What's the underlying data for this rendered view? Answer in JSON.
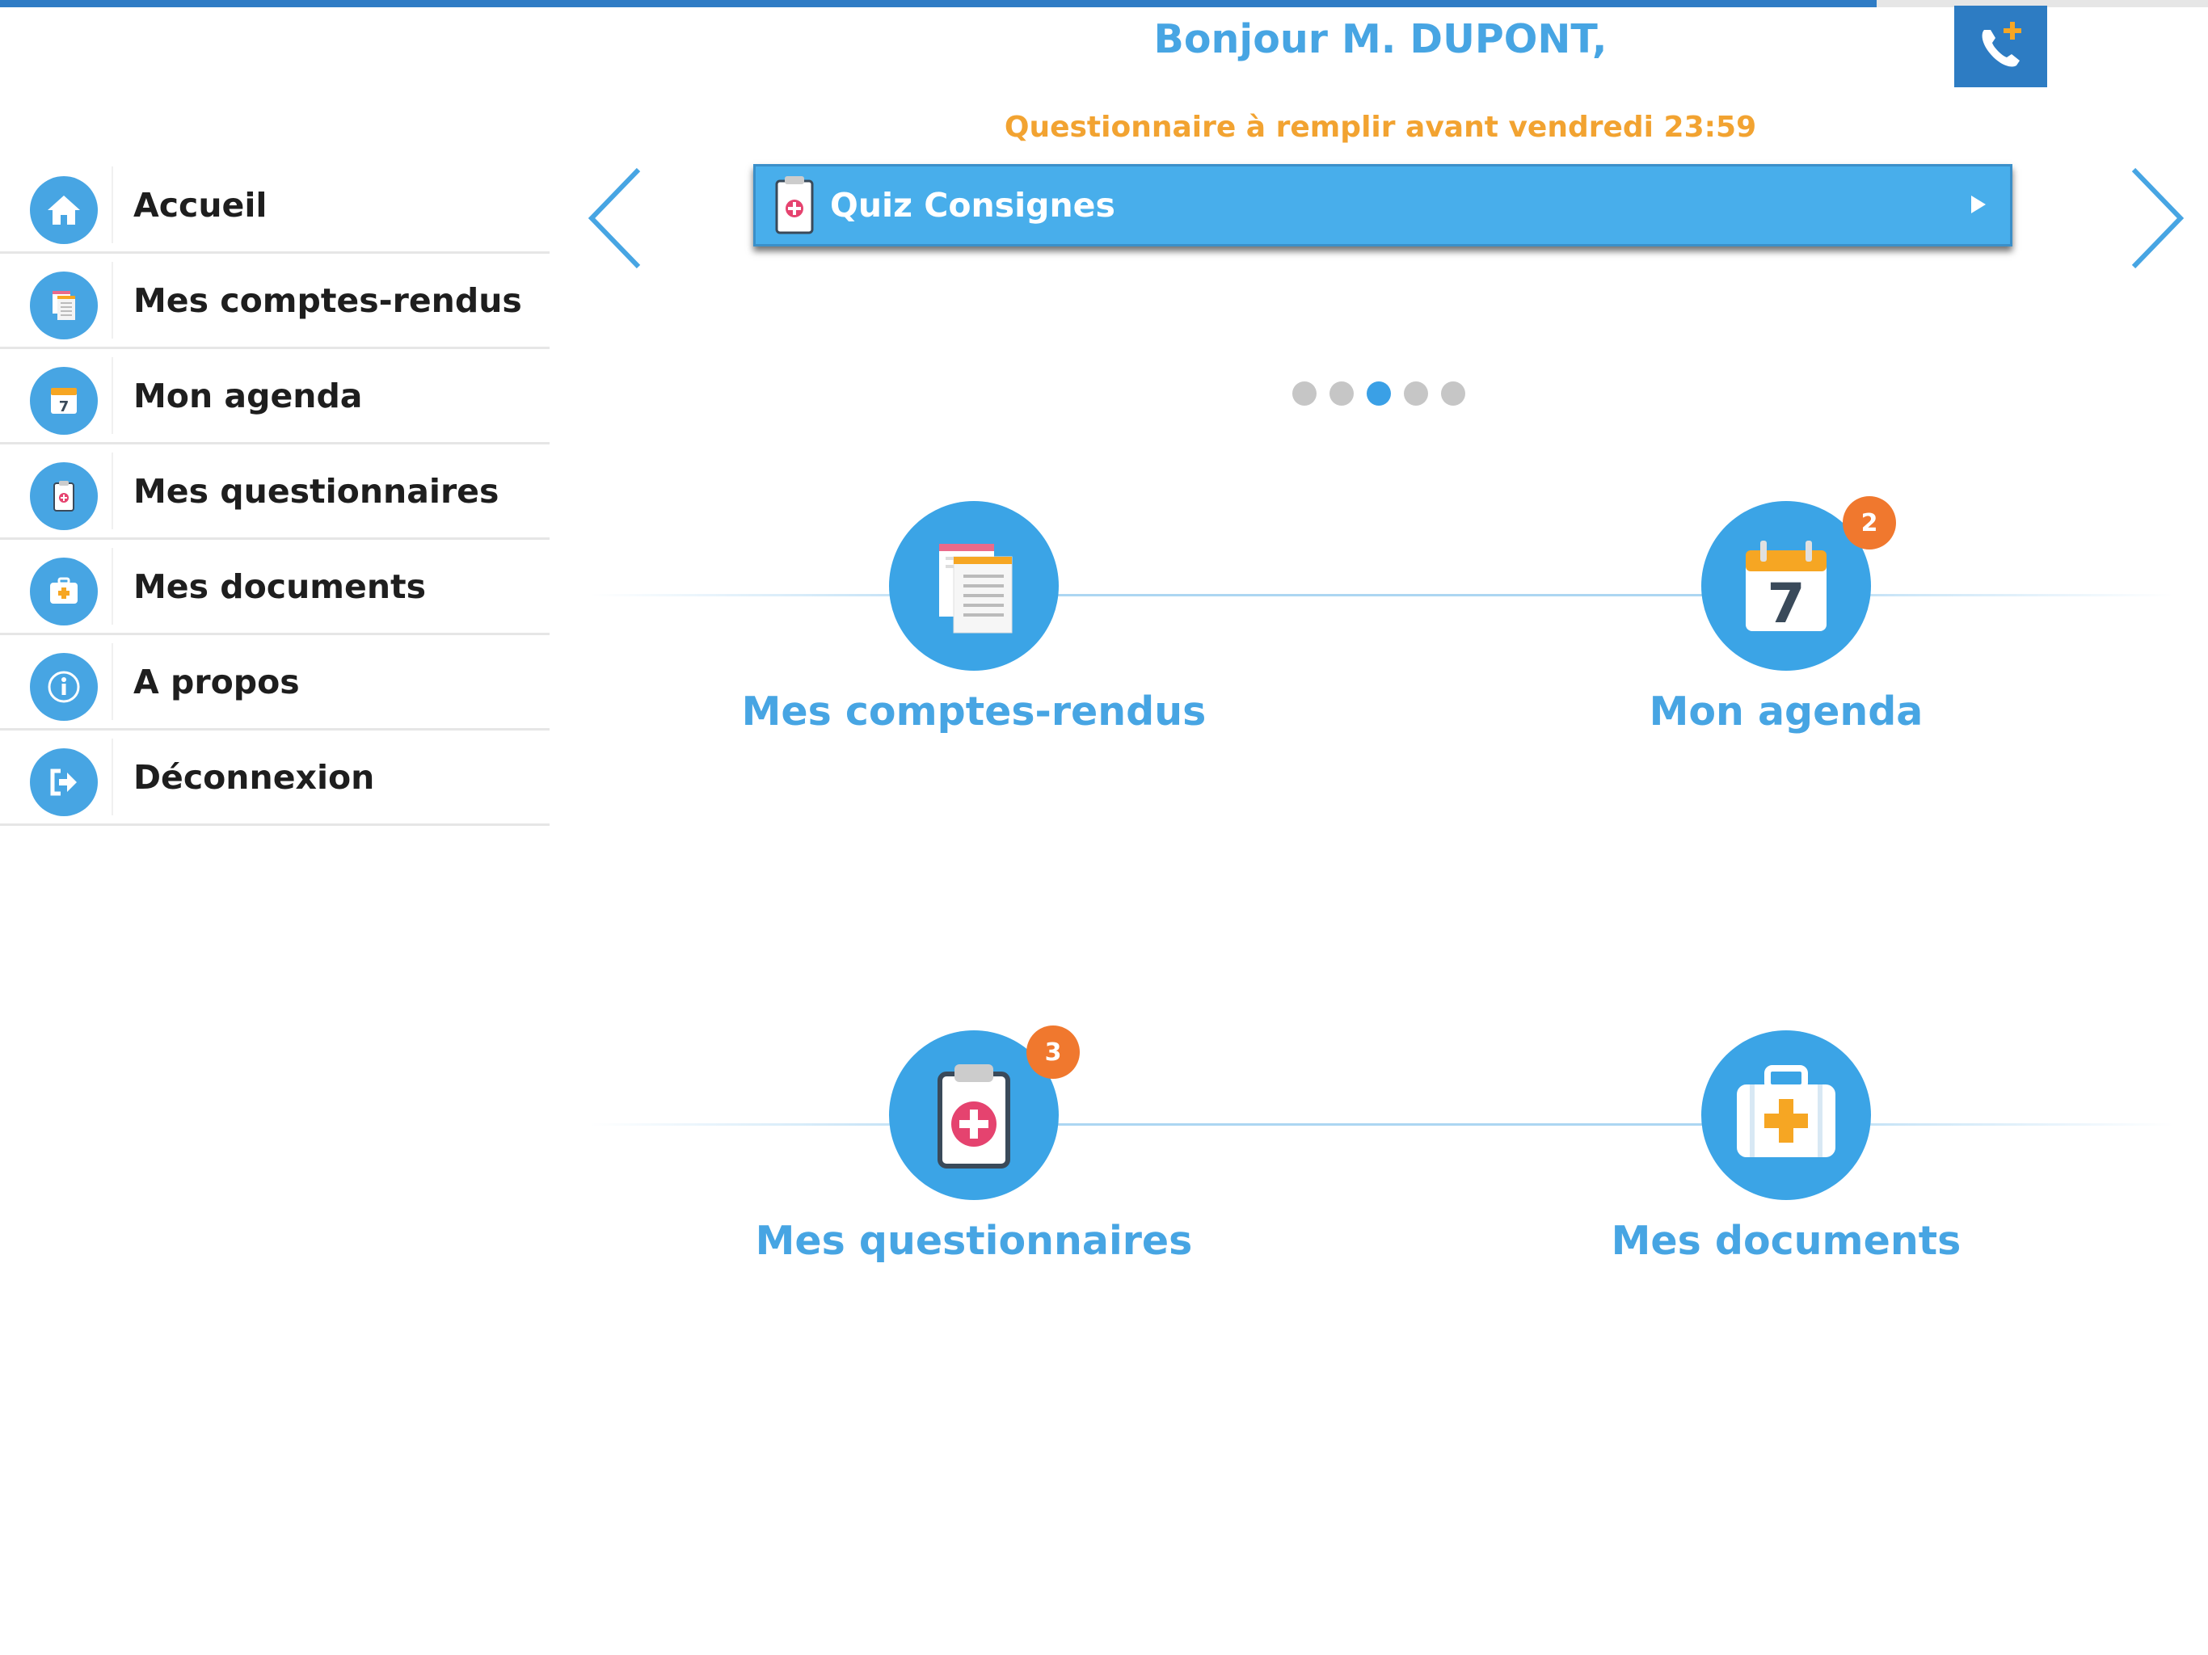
{
  "header": {
    "progress": 0.85,
    "greeting": "Bonjour M. DUPONT,",
    "deadline": "Questionnaire à remplir avant vendredi 23:59",
    "call_icon": "phone-add-icon"
  },
  "sidebar": {
    "items": [
      {
        "label": "Accueil",
        "icon": "home-icon"
      },
      {
        "label": "Mes comptes-rendus",
        "icon": "reports-icon"
      },
      {
        "label": "Mon agenda",
        "icon": "calendar-icon"
      },
      {
        "label": "Mes questionnaires",
        "icon": "clipboard-icon"
      },
      {
        "label": "Mes documents",
        "icon": "medical-case-icon"
      },
      {
        "label": "A propos",
        "icon": "info-icon"
      },
      {
        "label": "Déconnexion",
        "icon": "logout-icon"
      }
    ]
  },
  "carousel": {
    "card_label": "Quiz Consignes",
    "card_icon": "clipboard-icon",
    "slide_count": 5,
    "active_index": 2
  },
  "tiles": [
    {
      "label": "Mes comptes-rendus",
      "icon": "reports-icon",
      "badge": ""
    },
    {
      "label": "Mon agenda",
      "icon": "calendar-icon",
      "badge": "2"
    },
    {
      "label": "Mes questionnaires",
      "icon": "clipboard-icon",
      "badge": "3"
    },
    {
      "label": "Mes documents",
      "icon": "medical-case-icon",
      "badge": ""
    }
  ],
  "colors": {
    "brand_blue": "#47a5e3",
    "dark_blue": "#2d7cc3",
    "deadline_orange": "#f2a331",
    "badge_orange": "#f0782e"
  }
}
